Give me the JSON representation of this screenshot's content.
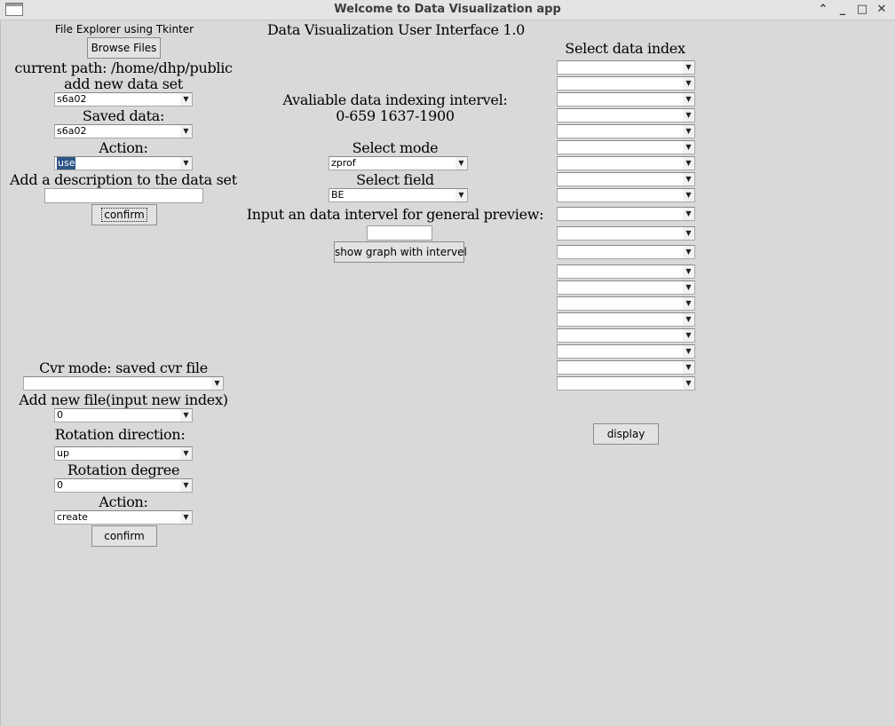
{
  "window": {
    "title": "Welcome to Data Visualization app",
    "minimize_icon": "minimize",
    "maximize_icon": "maximize",
    "close_icon": "close"
  },
  "left_panel": {
    "file_explorer_label": "File Explorer using Tkinter",
    "browse_button": "Browse Files",
    "current_path": "current path: /home/dhp/public",
    "add_new_data_set_label": "add new data set",
    "add_new_data_set_value": "s6a02",
    "saved_data_label": "Saved data:",
    "saved_data_value": "s6a02",
    "action_label": "Action:",
    "action_value": "use",
    "description_label": "Add a description to the data set",
    "description_value": "",
    "confirm_button": "confirm"
  },
  "center_panel": {
    "title": "Data Visualization User Interface 1.0",
    "available_indexing_label": "Avaliable data indexing intervel:",
    "available_indexing_value": "0-659 1637-1900",
    "select_mode_label": "Select mode",
    "select_mode_value": "zprof",
    "select_field_label": "Select field",
    "select_field_value": "BE",
    "preview_interval_label": "Input an data intervel for general preview:",
    "preview_interval_value": "",
    "show_graph_button": "show graph with intervel"
  },
  "right_panel": {
    "select_index_label": "Select data index",
    "index_dropdowns": [
      "",
      "",
      "",
      "",
      "",
      "",
      "",
      "",
      "",
      "",
      "",
      "",
      "",
      "",
      "",
      "",
      "",
      "",
      "",
      "",
      ""
    ],
    "display_button": "display"
  },
  "cvr_panel": {
    "cvr_mode_label": "Cvr mode: saved cvr file",
    "cvr_file_value": "",
    "add_new_file_label": "Add new file(input new index)",
    "add_new_file_value": "0",
    "rotation_direction_label": "Rotation direction:",
    "rotation_direction_value": "up",
    "rotation_degree_label": "Rotation degree",
    "rotation_degree_value": "0",
    "action_label": "Action:",
    "action_value": "create",
    "confirm_button": "confirm"
  }
}
